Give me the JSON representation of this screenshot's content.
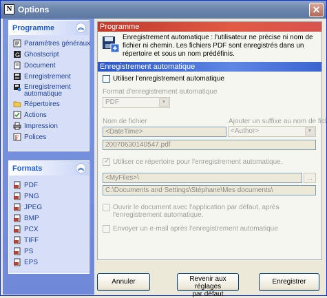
{
  "window": {
    "title": "Options",
    "close_glyph": "✕",
    "app_icon_letter": "N"
  },
  "sidebar": {
    "programme": {
      "title": "Programme",
      "items": [
        {
          "label": "Paramètres généraux",
          "icon": "settings-icon"
        },
        {
          "label": "Ghostscript",
          "icon": "ghostscript-icon"
        },
        {
          "label": "Document",
          "icon": "document-icon"
        },
        {
          "label": "Enregistrement",
          "icon": "save-icon"
        },
        {
          "label": "Enregistrement automatique",
          "icon": "auto-save-icon"
        },
        {
          "label": "Répertoires",
          "icon": "folder-icon"
        },
        {
          "label": "Actions",
          "icon": "actions-icon"
        },
        {
          "label": "Impression",
          "icon": "printer-icon"
        },
        {
          "label": "Polices",
          "icon": "fonts-icon"
        }
      ]
    },
    "formats": {
      "title": "Formats",
      "items": [
        {
          "label": "PDF"
        },
        {
          "label": "PNG"
        },
        {
          "label": "JPEG"
        },
        {
          "label": "BMP"
        },
        {
          "label": "PCX"
        },
        {
          "label": "TIFF"
        },
        {
          "label": "PS"
        },
        {
          "label": "EPS"
        }
      ]
    }
  },
  "main": {
    "programme_header": "Programme",
    "programme_desc": "Enregistrement automatique : l'utilisateur ne précise ni nom de fichier ni chemin. Les fichiers PDF sont enregistrés dans un répertoire et sous un nom prédéfinis.",
    "auto_header": "Enregistrement automatique",
    "use_auto_label": "Utiliser l'enregistrement automatique",
    "format_label": "Format d'enregistrement automatique",
    "format_value": "PDF",
    "filename_label": "Nom de fichier",
    "filename_value": "<DateTime>",
    "suffix_label": "Ajouter un suffixe au nom de fichier",
    "suffix_value": "<Author>",
    "filename_preview": "20070630140547.pdf",
    "use_dir_label": "Utiliser ce répertoire pour l'enregistrement automatique.",
    "dir_value": "<MyFiles>\\",
    "dir_preview": "C:\\Documents and Settings\\Stéphane\\Mes documents\\",
    "browse_label": "...",
    "open_doc_label": "Ouvrir le document avec l'application par défaut, après l'enregistrement automatique.",
    "email_label": "Envoyer un e-mail après l'enregistrement automatique"
  },
  "buttons": {
    "cancel": "Annuler",
    "defaults_line1": "Revenir aux réglages",
    "defaults_line2": "par défaut",
    "save": "Enregistrer"
  }
}
